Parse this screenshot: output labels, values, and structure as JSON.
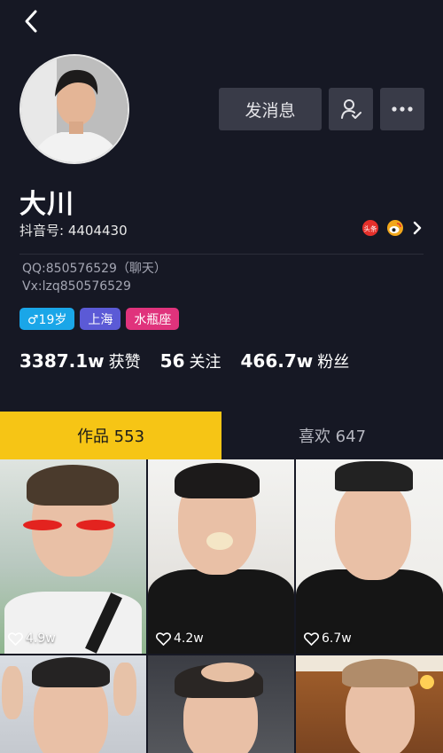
{
  "profile": {
    "name": "大川",
    "douyin_id": "抖音号: 4404430",
    "bio_line1": "QQ:850576529（聊天）",
    "bio_line2": "Vx:lzq850576529"
  },
  "actions": {
    "message_label": "发消息"
  },
  "share": {
    "toutiao_label": "头条"
  },
  "tags": [
    {
      "label": "♂19岁",
      "color": "#1aa6e8"
    },
    {
      "label": "上海",
      "color": "#5b5ad6"
    },
    {
      "label": "水瓶座",
      "color": "#e0337c"
    }
  ],
  "stats": {
    "likes_num": "3387.1w",
    "likes_label": "获赞",
    "following_num": "56",
    "following_label": "关注",
    "fans_num": "466.7w",
    "fans_label": "粉丝"
  },
  "tabs": {
    "works": "作品 553",
    "likes": "喜欢 647"
  },
  "videos": [
    {
      "likes": "4.9w"
    },
    {
      "likes": "4.2w"
    },
    {
      "likes": "6.7w"
    }
  ],
  "colors": {
    "background": "#161824",
    "accent_tab": "#f6c515",
    "button_bg": "#393b48"
  },
  "icons": [
    "back-arrow-icon",
    "follow-user-icon",
    "more-dots-icon",
    "toutiao-icon",
    "weibo-icon",
    "chevron-right-icon",
    "heart-icon"
  ]
}
